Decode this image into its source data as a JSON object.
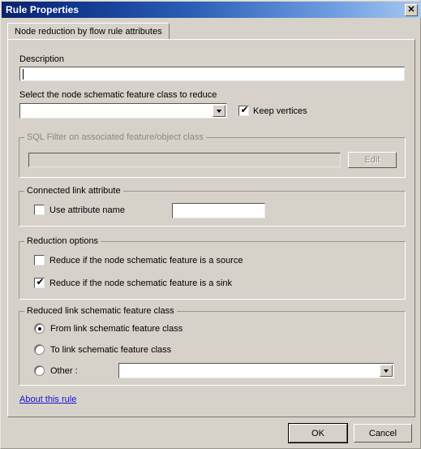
{
  "window": {
    "title": "Rule Properties",
    "close_icon": "close-icon",
    "close_glyph": "✕"
  },
  "tabs": [
    {
      "label": "Node reduction by flow rule attributes",
      "selected": true
    }
  ],
  "form": {
    "description": {
      "label": "Description",
      "value": "",
      "placeholder": ""
    },
    "node_feature_class": {
      "label": "Select the node schematic feature class to reduce",
      "value": "",
      "options": []
    },
    "keep_vertices": {
      "label": "Keep vertices",
      "checked": true,
      "check_glyph": "✔"
    },
    "sql_filter": {
      "group_label": "SQL Filter on associated feature/object class",
      "value": "",
      "enabled": false,
      "edit_button": "Edit"
    },
    "connected_link_attribute": {
      "group_label": "Connected link attribute",
      "use_attribute_name": {
        "label": "Use attribute name",
        "checked": false,
        "check_glyph": "✔"
      },
      "attribute_value": ""
    },
    "reduction_options": {
      "group_label": "Reduction options",
      "items": [
        {
          "label": "Reduce if the node schematic feature is a source",
          "checked": false,
          "check_glyph": "✔"
        },
        {
          "label": "Reduce if the node schematic feature is a sink",
          "checked": true,
          "check_glyph": "✔"
        }
      ]
    },
    "reduced_link_class": {
      "group_label": "Reduced link schematic feature class",
      "options": [
        {
          "label": "From link schematic feature class",
          "selected": true
        },
        {
          "label": "To link schematic feature class",
          "selected": false
        },
        {
          "label": "Other :",
          "selected": false
        }
      ],
      "other_value": "",
      "other_options": []
    },
    "about_link": "About this rule"
  },
  "footer": {
    "ok_label": "OK",
    "cancel_label": "Cancel"
  },
  "colors": {
    "title_start": "#0a246a",
    "title_end": "#a6c8f0",
    "dialog_bg": "#d6d2ca",
    "link": "#1414d2",
    "field_bg": "#ffffff"
  }
}
